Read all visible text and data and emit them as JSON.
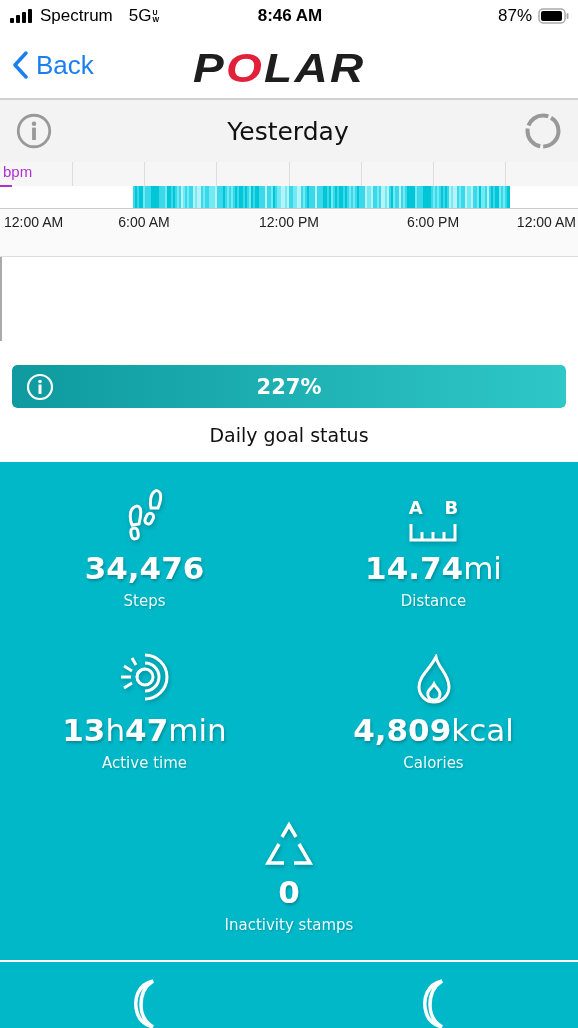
{
  "status_bar": {
    "carrier": "Spectrum",
    "network": "5G",
    "network_badge": "UW",
    "time": "8:46 AM",
    "battery": "87%"
  },
  "nav": {
    "back": "Back",
    "logo": "POLAR"
  },
  "day_header": {
    "title": "Yesterday"
  },
  "activity_chart": {
    "unit": "bpm",
    "time_labels": [
      "12:00 AM",
      "6:00 AM",
      "12:00 PM",
      "6:00 PM",
      "12:00 AM"
    ]
  },
  "goal": {
    "percent": "227%",
    "caption": "Daily goal status"
  },
  "stats": [
    {
      "kind": "steps",
      "value": [
        {
          "text": "34,476",
          "bold": true
        }
      ],
      "label": "Steps"
    },
    {
      "kind": "distance",
      "value": [
        {
          "text": "14.74",
          "bold": true
        },
        {
          "text": "mi",
          "bold": false
        }
      ],
      "label": "Distance",
      "icon_letters": [
        "A",
        "B"
      ]
    },
    {
      "kind": "active",
      "value": [
        {
          "text": "13",
          "bold": true
        },
        {
          "text": "h",
          "bold": false
        },
        {
          "text": "47",
          "bold": true
        },
        {
          "text": "min",
          "bold": false
        }
      ],
      "label": "Active time"
    },
    {
      "kind": "calories",
      "value": [
        {
          "text": "4,809",
          "bold": true
        },
        {
          "text": "kcal",
          "bold": false
        }
      ],
      "label": "Calories"
    },
    {
      "kind": "inactivity",
      "value": [
        {
          "text": "0",
          "bold": true
        }
      ],
      "label": "Inactivity stamps"
    }
  ]
}
